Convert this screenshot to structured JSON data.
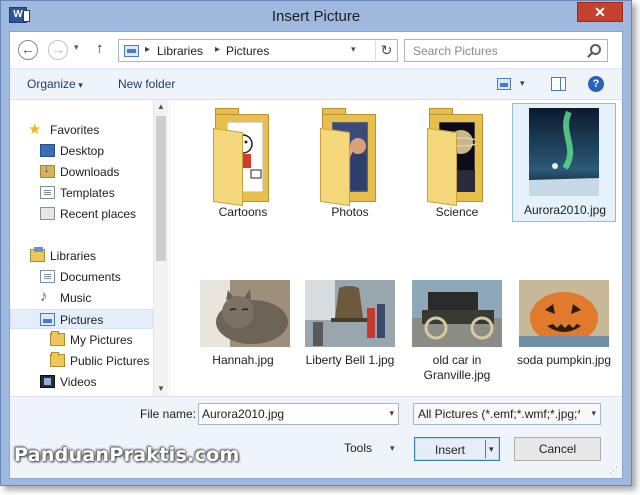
{
  "window": {
    "title": "Insert Picture",
    "close_label": "✕"
  },
  "nav": {
    "address": [
      "Libraries",
      "Pictures"
    ],
    "search_placeholder": "Search Pictures"
  },
  "toolbar": {
    "organize_label": "Organize",
    "new_folder_label": "New folder",
    "help_label": "?"
  },
  "sidebar": {
    "items": [
      {
        "label": "Favorites",
        "icon": "star-icon"
      },
      {
        "label": "Desktop",
        "icon": "desktop-icon"
      },
      {
        "label": "Downloads",
        "icon": "downloads-icon"
      },
      {
        "label": "Templates",
        "icon": "templates-icon"
      },
      {
        "label": "Recent places",
        "icon": "recent-places-icon"
      },
      {
        "label": "Libraries",
        "icon": "libraries-icon"
      },
      {
        "label": "Documents",
        "icon": "documents-icon"
      },
      {
        "label": "Music",
        "icon": "music-icon"
      },
      {
        "label": "Pictures",
        "icon": "pictures-icon",
        "selected": true
      },
      {
        "label": "My Pictures",
        "icon": "folder-icon"
      },
      {
        "label": "Public Pictures",
        "icon": "folder-icon"
      },
      {
        "label": "Videos",
        "icon": "videos-icon"
      }
    ]
  },
  "files": [
    {
      "name": "Cartoons",
      "type": "folder"
    },
    {
      "name": "Photos",
      "type": "folder"
    },
    {
      "name": "Science",
      "type": "folder"
    },
    {
      "name": "Aurora2010.jpg",
      "type": "image",
      "selected": true
    },
    {
      "name": "Hannah.jpg",
      "type": "image"
    },
    {
      "name": "Liberty Bell 1.jpg",
      "type": "image"
    },
    {
      "name": "old car in Granville.jpg",
      "type": "image"
    },
    {
      "name": "soda pumpkin.jpg",
      "type": "image"
    }
  ],
  "footer": {
    "file_name_label": "File name:",
    "file_name_value": "Aurora2010.jpg",
    "file_type_value": "All Pictures (*.emf;*.wmf;*.jpg;*",
    "tools_label": "Tools",
    "insert_label": "Insert",
    "cancel_label": "Cancel"
  },
  "watermark": "PanduanPraktis.com",
  "colors": {
    "title_bar": "#9fb8de",
    "close_button": "#c7402c",
    "selection": "#e5f1fb",
    "toolbar": "#eff3fa"
  }
}
